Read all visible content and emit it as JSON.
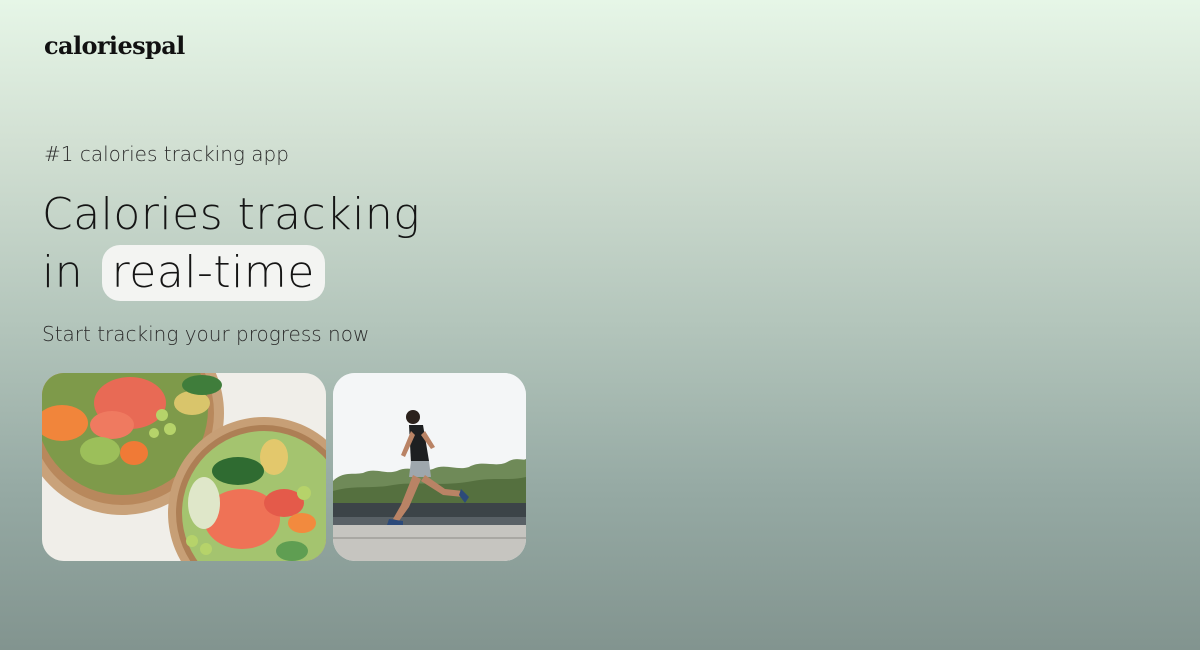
{
  "brand": {
    "logo_text": "caloriespal"
  },
  "hero": {
    "tagline": "#1 calories tracking app",
    "headline_line1": "Calories tracking",
    "headline_in": "in",
    "headline_highlight": "real-time",
    "subtitle": "Start tracking your progress now"
  },
  "images": [
    {
      "name": "food-bowls-photo",
      "subject": "poke bowls with salmon, avocado, edamame and cucumber"
    },
    {
      "name": "runner-photo",
      "subject": "man jogging along a riverside path with trees"
    }
  ],
  "colors": {
    "background_top": "#e6f6e7",
    "background_bottom": "#82948f",
    "highlight_pill": "#f3f4f2",
    "text": "#151515"
  }
}
